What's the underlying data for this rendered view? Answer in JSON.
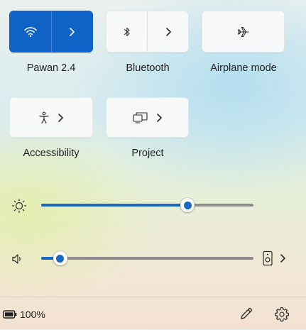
{
  "tiles": {
    "wifi": {
      "label": "Pawan 2.4",
      "icon": "wifi-icon",
      "active": true
    },
    "bluetooth": {
      "label": "Bluetooth",
      "icon": "bluetooth-icon",
      "active": false
    },
    "airplane": {
      "label": "Airplane mode",
      "icon": "airplane-icon",
      "active": false
    },
    "accessibility": {
      "label": "Accessibility",
      "icon": "accessibility-icon",
      "active": false
    },
    "project": {
      "label": "Project",
      "icon": "project-icon",
      "active": false
    }
  },
  "brightness": {
    "icon": "brightness-icon",
    "level": 0.69
  },
  "volume": {
    "icon": "speaker-icon",
    "level": 0.09,
    "output_icon": "audio-output-icon"
  },
  "footer": {
    "battery_text": "100%",
    "battery_icon": "battery-icon",
    "edit_icon": "pencil-icon",
    "settings_icon": "gear-icon"
  },
  "colors": {
    "accent": "#0f62c6",
    "slider_fill": "#1a67c4",
    "track": "#8d8d8d"
  }
}
